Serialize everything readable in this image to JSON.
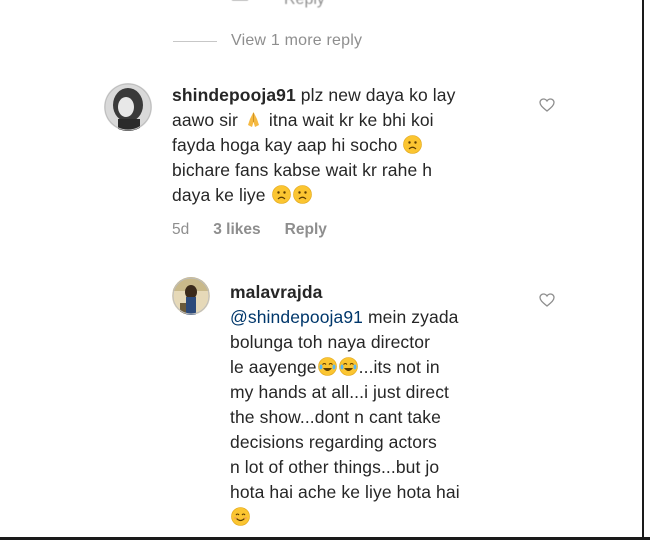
{
  "top_partial": {
    "left_text": "—",
    "right_text": "Reply"
  },
  "view_more": {
    "label": "View 1 more reply"
  },
  "comment1": {
    "username": "shindepooja91",
    "text_parts": [
      "plz new daya ko lay",
      "aawo sir",
      "itna wait kr ke bhi koi",
      "fayda hoga kay aap hi socho",
      "bichare fans kabse wait kr rahe h",
      "daya ke liye"
    ],
    "emojis": [
      "folded-hands-emoji",
      "frowning-face-emoji",
      "frowning-face-emoji",
      "frowning-face-emoji"
    ],
    "time": "5d",
    "likes": "3 likes",
    "reply": "Reply"
  },
  "comment2": {
    "username": "malavrajda",
    "mention": "@shindepooja91",
    "text_parts": [
      "mein zyada",
      "bolunga toh naya director",
      "le aayenge",
      "...its not in",
      "my hands at all...i just direct",
      "the show...dont n cant take",
      "decisions regarding actors",
      "n lot of other things...but jo",
      "hota hai ache ke liye hota hai"
    ],
    "emojis": [
      "tears-of-joy-emoji",
      "tears-of-joy-emoji",
      "smiling-face-emoji"
    ]
  },
  "colors": {
    "text": "#262626",
    "muted": "#8e8e8e",
    "mention": "#00376b",
    "emoji_yellow": "#fbc531"
  }
}
